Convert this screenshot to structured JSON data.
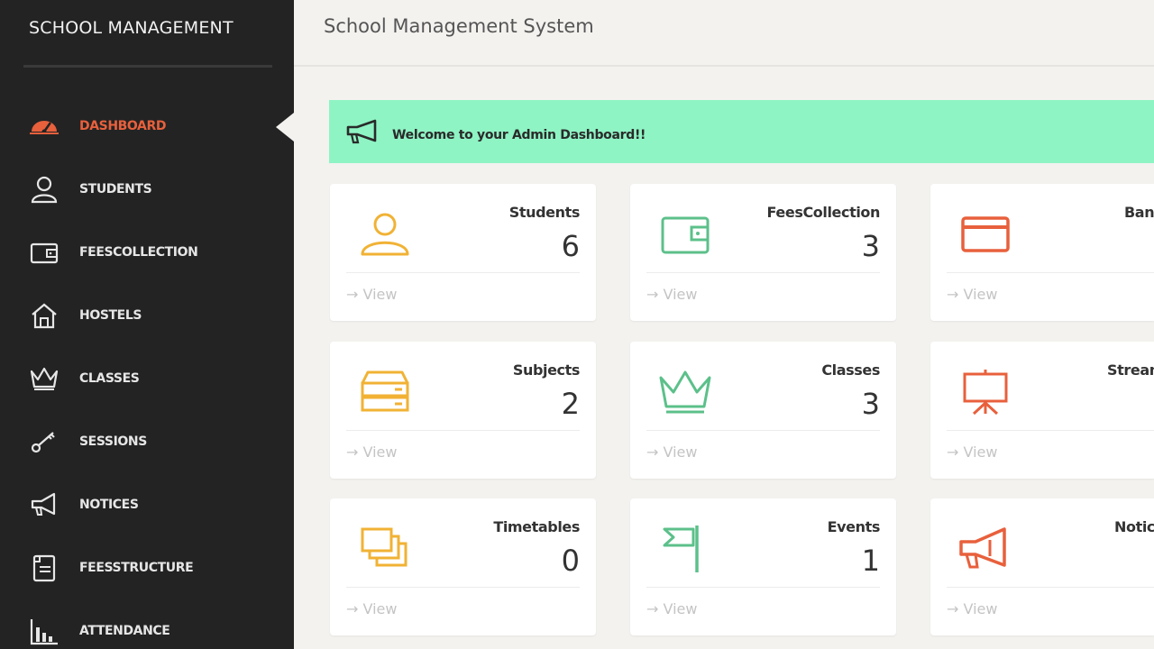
{
  "sidebar": {
    "brand": "SCHOOL MANAGEMENT",
    "items": [
      {
        "label": "DASHBOARD",
        "icon": "dashboard-icon",
        "active": true
      },
      {
        "label": "STUDENTS",
        "icon": "user-icon",
        "active": false
      },
      {
        "label": "FEESCOLLECTION",
        "icon": "wallet-icon",
        "active": false
      },
      {
        "label": "HOSTELS",
        "icon": "home-icon",
        "active": false
      },
      {
        "label": "CLASSES",
        "icon": "crown-icon",
        "active": false
      },
      {
        "label": "SESSIONS",
        "icon": "key-icon",
        "active": false
      },
      {
        "label": "NOTICES",
        "icon": "megaphone-icon",
        "active": false
      },
      {
        "label": "FEESSTRUCTURE",
        "icon": "document-icon",
        "active": false
      },
      {
        "label": "ATTENDANCE",
        "icon": "bar-chart-icon",
        "active": false
      }
    ]
  },
  "header": {
    "title": "School Management System"
  },
  "banner": {
    "text": "Welcome to your Admin Dashboard!!",
    "icon": "megaphone-icon"
  },
  "cards": [
    {
      "title": "Students",
      "count": "6",
      "view": "View",
      "icon": "user-icon",
      "color": "#f1b234"
    },
    {
      "title": "FeesCollection",
      "count": "3",
      "view": "View",
      "icon": "wallet-icon",
      "color": "#5cc08a"
    },
    {
      "title": "Banks",
      "count": "",
      "view": "View",
      "icon": "card-icon",
      "color": "#e8603c"
    },
    {
      "title": "Subjects",
      "count": "2",
      "view": "View",
      "icon": "server-icon",
      "color": "#f1b234"
    },
    {
      "title": "Classes",
      "count": "3",
      "view": "View",
      "icon": "crown-icon",
      "color": "#5cc08a"
    },
    {
      "title": "Streams",
      "count": "",
      "view": "View",
      "icon": "easel-icon",
      "color": "#e8603c"
    },
    {
      "title": "Timetables",
      "count": "0",
      "view": "View",
      "icon": "copy-icon",
      "color": "#f1b234"
    },
    {
      "title": "Events",
      "count": "1",
      "view": "View",
      "icon": "flag-icon",
      "color": "#5cc08a"
    },
    {
      "title": "Notices",
      "count": "",
      "view": "View",
      "icon": "megaphone-icon",
      "color": "#e8603c"
    }
  ],
  "colors": {
    "accent": "#e8603c",
    "sidebar_bg": "#232323",
    "banner_bg": "#8ef4c4"
  }
}
